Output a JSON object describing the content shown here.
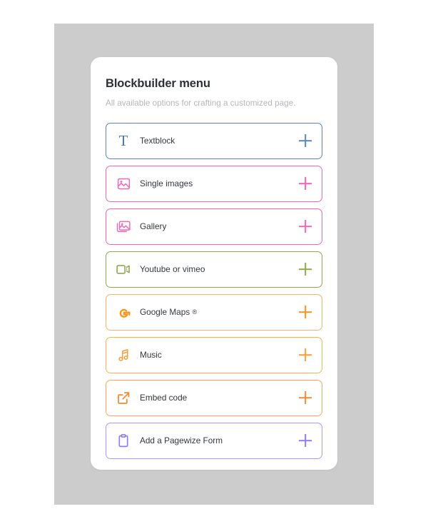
{
  "card": {
    "title": "Blockbuilder menu",
    "subtitle": "All available options for crafting a customized page."
  },
  "colors": {
    "page_background": "#ffffff",
    "panel_background": "#cccccc",
    "card_background": "#ffffff",
    "title_text": "#2b3137",
    "subtitle_text": "#b3b7bb",
    "label_text": "#33383d"
  },
  "options": [
    {
      "label": "Textblock",
      "icon": "textblock-icon",
      "color": "#5b86b5",
      "add_label": "+"
    },
    {
      "label": "Single images",
      "icon": "single-image-icon",
      "color": "#ef66b2",
      "add_label": "+"
    },
    {
      "label": "Gallery",
      "icon": "gallery-icon",
      "color": "#ef66b2",
      "add_label": "+"
    },
    {
      "label": "Youtube or vimeo",
      "icon": "video-camera-icon",
      "color": "#8faa4e",
      "add_label": "+"
    },
    {
      "label": "Google Maps ",
      "label_suffix": "®",
      "icon": "google-g-icon",
      "color": "#f7941d",
      "add_label": "+"
    },
    {
      "label": "Music",
      "icon": "music-note-icon",
      "color": "#f5a03c",
      "add_label": "+"
    },
    {
      "label": "Embed code",
      "icon": "external-link-icon",
      "color": "#f58a2e",
      "add_label": "+"
    },
    {
      "label": "Add a Pagewize Form",
      "icon": "clipboard-icon",
      "color": "#8f7cf0",
      "add_label": "+"
    }
  ]
}
